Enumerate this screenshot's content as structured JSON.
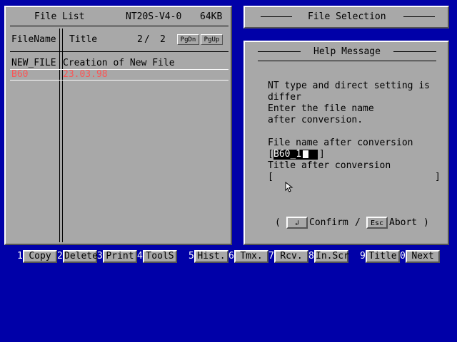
{
  "file_list": {
    "title": "File List",
    "model": "NT20S-V4-0",
    "size": "64KB",
    "col_filename": "FileName",
    "col_title": "Title",
    "page_current": "2",
    "page_sep": "/",
    "page_total": "2",
    "pgdn": "PgDn",
    "pgup": "PgUp",
    "rows": [
      {
        "filename": "NEW_FILE",
        "title": "Creation of New File"
      },
      {
        "filename": "B60",
        "title": "23.03.98"
      }
    ]
  },
  "file_selection": {
    "title": "File Selection"
  },
  "help": {
    "title": "Help Message",
    "line1": "NT type and direct setting is",
    "line2": "differ",
    "line3": "Enter the file name",
    "line4": "after conversion.",
    "file_name_label": "File name after conversion",
    "bracket_open": "[",
    "bracket_close": "]",
    "file_name_value": "B60_1",
    "title_label": "Title after conversion",
    "title_value": "",
    "paren_open": "(",
    "enter_key": "↲",
    "confirm": "Confirm",
    "slash": "/",
    "esc_key": "Esc",
    "abort": "Abort",
    "paren_close": ")"
  },
  "function_keys": [
    {
      "num": "1",
      "label": "Copy"
    },
    {
      "num": "2",
      "label": "Delete"
    },
    {
      "num": "3",
      "label": "Print"
    },
    {
      "num": "4",
      "label": "ToolS"
    },
    {
      "num": "5",
      "label": "Hist."
    },
    {
      "num": "6",
      "label": "Tmx."
    },
    {
      "num": "7",
      "label": "Rcv."
    },
    {
      "num": "8",
      "label": "In.Scr"
    },
    {
      "num": "9",
      "label": "Title"
    },
    {
      "num": "0",
      "label": "Next"
    }
  ],
  "colors": {
    "background": "#0000a8",
    "panel": "#a8a8a8",
    "highlight": "#fc5454",
    "text": "#000000",
    "fn_number": "#fcfcfc"
  }
}
